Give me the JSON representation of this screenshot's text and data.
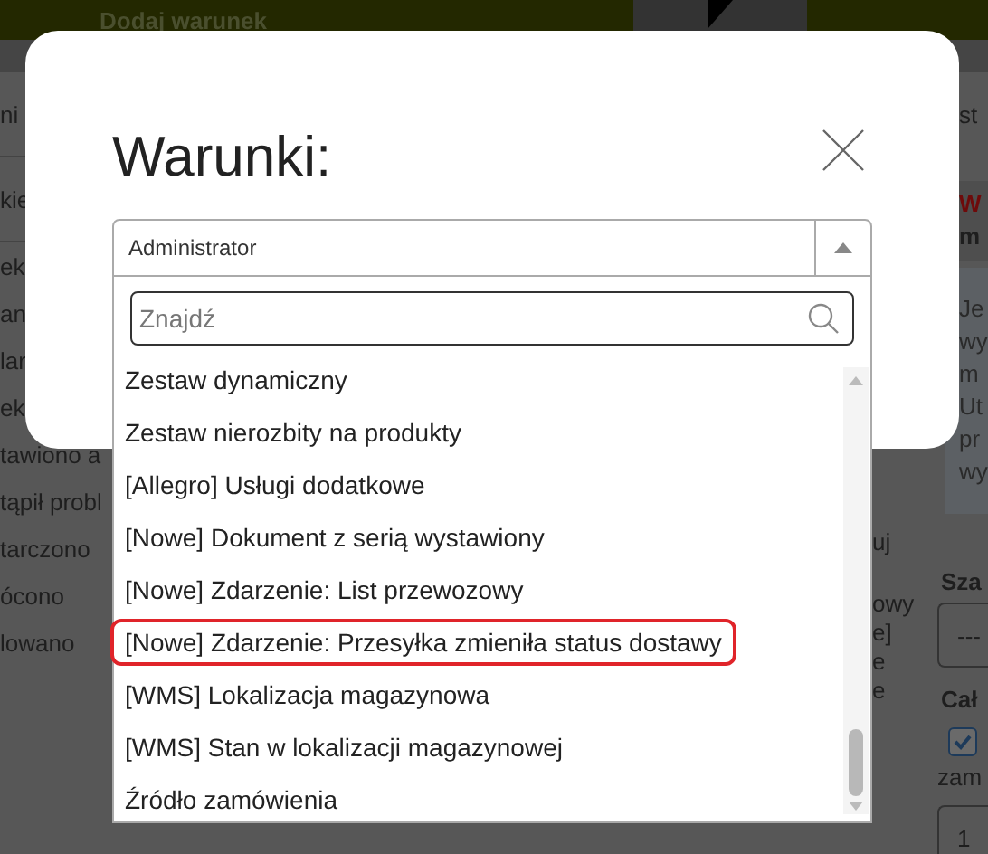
{
  "top_bar": {
    "title": "Dodaj warunek"
  },
  "background": {
    "left_texts": [
      "ni",
      "kie",
      "ek",
      "an",
      "lar",
      "ek",
      "tawiono a",
      "tąpił probl",
      "tarczono",
      "ócono",
      "lowano"
    ],
    "middle_texts": [
      "uj",
      "owy",
      "e]",
      "e",
      "e"
    ],
    "right_header": "st",
    "warning": {
      "title": "W",
      "subtitle": "m"
    },
    "info_lines": [
      "Je",
      "wy",
      "m",
      "Ut",
      "pr",
      "wy"
    ],
    "field_label": "Sza",
    "select_value": "---",
    "section_label": "Cał",
    "checkbox": {
      "checked": true,
      "label": "zam"
    },
    "number_value": "1"
  },
  "dialog": {
    "title": "Warunki:",
    "select_value": "Administrator",
    "search": {
      "placeholder": "Znajdź"
    },
    "options": [
      {
        "label": "Zestaw dynamiczny",
        "highlighted": false
      },
      {
        "label": "Zestaw nierozbity na produkty",
        "highlighted": false
      },
      {
        "label": "[Allegro] Usługi dodatkowe",
        "highlighted": false
      },
      {
        "label": "[Nowe] Dokument z serią wystawiony",
        "highlighted": false
      },
      {
        "label": "[Nowe] Zdarzenie: List przewozowy",
        "highlighted": false
      },
      {
        "label": "[Nowe] Zdarzenie: Przesyłka zmieniła status dostawy",
        "highlighted": true
      },
      {
        "label": "[WMS] Lokalizacja magazynowa",
        "highlighted": false
      },
      {
        "label": "[WMS] Stan w lokalizacji magazynowej",
        "highlighted": false
      },
      {
        "label": "Źródło zamówienia",
        "highlighted": false
      }
    ]
  }
}
